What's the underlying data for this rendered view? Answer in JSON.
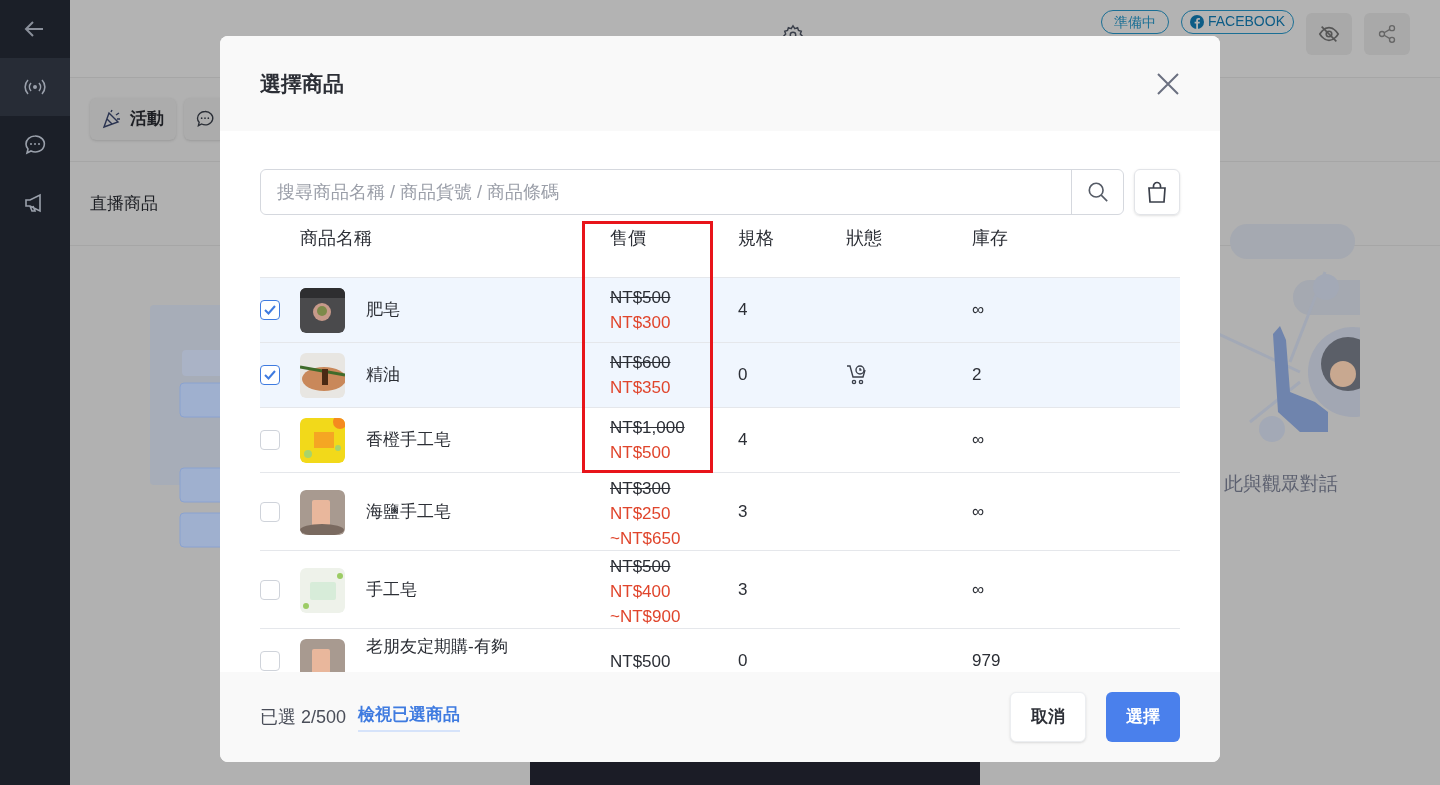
{
  "sidebar": {
    "items": [
      {
        "kind": "back",
        "selected": false
      },
      {
        "kind": "live",
        "selected": true
      },
      {
        "kind": "chat",
        "selected": false
      },
      {
        "kind": "megaphone",
        "selected": false
      }
    ]
  },
  "header": {
    "status_badge": "準備中",
    "platform_badge": "FACEBOOK"
  },
  "toolbar": {
    "buttons": [
      "活動"
    ]
  },
  "section_title": "直播商品",
  "chat_hint": "此與觀眾對話",
  "dialog": {
    "title": "選擇商品",
    "search": {
      "placeholder": "搜尋商品名稱 / 商品貨號 / 商品條碼"
    },
    "columns": [
      "商品名稱",
      "售價",
      "規格",
      "狀態",
      "庫存"
    ],
    "rows": [
      {
        "selected": true,
        "name": "肥皂",
        "prices": [
          {
            "text": "NT$500",
            "kind": "original"
          },
          {
            "text": "NT$300",
            "kind": "sale"
          }
        ],
        "spec": "4",
        "status_icon": false,
        "stock": "∞"
      },
      {
        "selected": true,
        "name": "精油",
        "prices": [
          {
            "text": "NT$600",
            "kind": "original"
          },
          {
            "text": "NT$350",
            "kind": "sale"
          }
        ],
        "spec": "0",
        "status_icon": true,
        "stock": "2"
      },
      {
        "selected": false,
        "name": "香橙手工皂",
        "prices": [
          {
            "text": "NT$1,000",
            "kind": "original"
          },
          {
            "text": "NT$500",
            "kind": "sale"
          }
        ],
        "spec": "4",
        "status_icon": false,
        "stock": "∞"
      },
      {
        "selected": false,
        "name": "海鹽手工皂",
        "prices": [
          {
            "text": "NT$300",
            "kind": "original"
          },
          {
            "text": "NT$250",
            "kind": "sale"
          },
          {
            "text": "~NT$650",
            "kind": "sale"
          }
        ],
        "spec": "3",
        "status_icon": false,
        "stock": "∞"
      },
      {
        "selected": false,
        "name": "手工皂",
        "prices": [
          {
            "text": "NT$500",
            "kind": "original"
          },
          {
            "text": "NT$400",
            "kind": "sale"
          },
          {
            "text": "~NT$900",
            "kind": "sale"
          }
        ],
        "spec": "3",
        "status_icon": false,
        "stock": "∞"
      },
      {
        "selected": false,
        "name": "老朋友定期購-有夠",
        "prices": [
          {
            "text": "NT$500",
            "kind": "regular"
          }
        ],
        "spec": "0",
        "status_icon": false,
        "stock": "979"
      }
    ],
    "selected_count": "已選 2/500",
    "view_selected_link": "檢視已選商品",
    "buttons": [
      {
        "label": "取消",
        "kind": "secondary"
      },
      {
        "label": "選擇",
        "kind": "primary"
      }
    ]
  }
}
